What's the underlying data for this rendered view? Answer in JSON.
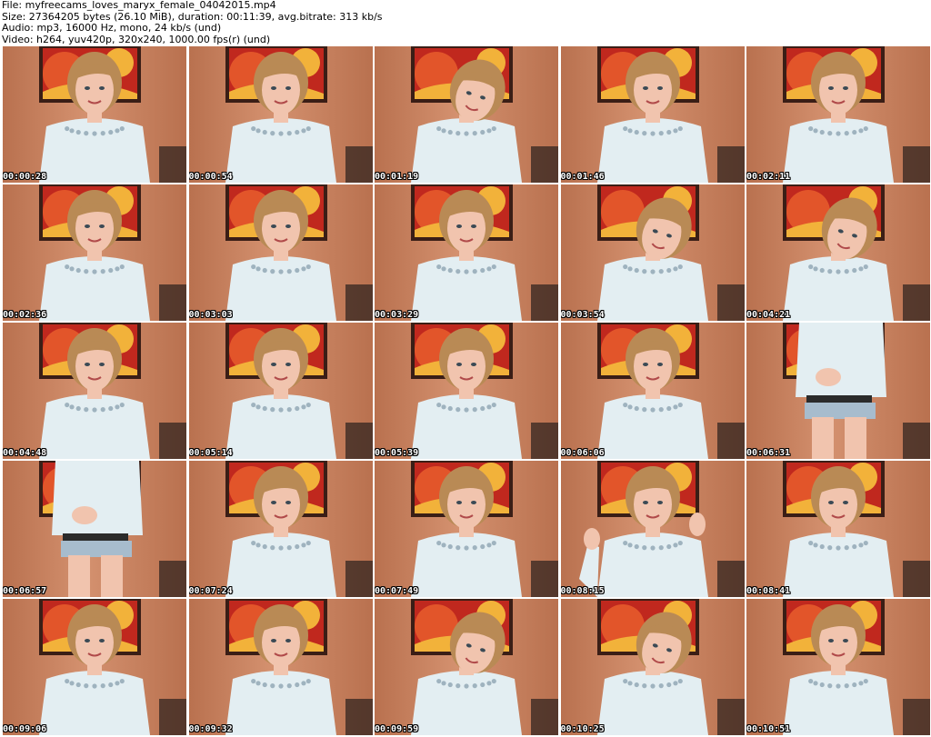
{
  "header": {
    "file_line": "File: myfreecams_loves_maryx_female_04042015.mp4",
    "size_line": "Size: 27364205 bytes (26.10 MiB), duration: 00:11:39, avg.bitrate: 313 kb/s",
    "audio_line": "Audio: mp3, 16000 Hz, mono, 24 kb/s (und)",
    "video_line": "Video: h264, yuv420p, 320x240, 1000.00 fps(r) (und)"
  },
  "colors": {
    "wall": "#d4916f",
    "wall_dark": "#b9714f",
    "painting_orange": "#e2552a",
    "painting_yellow": "#f2b23a",
    "painting_red": "#c0281e",
    "painting_dark": "#3a1e16",
    "sweater": "#e3eef2",
    "skin": "#f1c4ae",
    "hair": "#b98a55",
    "shorts": "#a7bccd",
    "timestamp_text": "#ffffff",
    "timestamp_outline": "#000000"
  },
  "thumbnails": [
    {
      "timestamp": "00:00:28",
      "pose": "portrait"
    },
    {
      "timestamp": "00:00:54",
      "pose": "portrait"
    },
    {
      "timestamp": "00:01:19",
      "pose": "head-down"
    },
    {
      "timestamp": "00:01:46",
      "pose": "portrait"
    },
    {
      "timestamp": "00:02:11",
      "pose": "portrait"
    },
    {
      "timestamp": "00:02:36",
      "pose": "portrait"
    },
    {
      "timestamp": "00:03:03",
      "pose": "portrait"
    },
    {
      "timestamp": "00:03:29",
      "pose": "portrait"
    },
    {
      "timestamp": "00:03:54",
      "pose": "head-down"
    },
    {
      "timestamp": "00:04:21",
      "pose": "head-down"
    },
    {
      "timestamp": "00:04:48",
      "pose": "portrait"
    },
    {
      "timestamp": "00:05:14",
      "pose": "portrait"
    },
    {
      "timestamp": "00:05:39",
      "pose": "portrait"
    },
    {
      "timestamp": "00:06:06",
      "pose": "portrait"
    },
    {
      "timestamp": "00:06:31",
      "pose": "standing"
    },
    {
      "timestamp": "00:06:57",
      "pose": "standing"
    },
    {
      "timestamp": "00:07:24",
      "pose": "portrait"
    },
    {
      "timestamp": "00:07:49",
      "pose": "portrait"
    },
    {
      "timestamp": "00:08:15",
      "pose": "hands-up"
    },
    {
      "timestamp": "00:08:41",
      "pose": "portrait"
    },
    {
      "timestamp": "00:09:06",
      "pose": "portrait"
    },
    {
      "timestamp": "00:09:32",
      "pose": "portrait"
    },
    {
      "timestamp": "00:09:59",
      "pose": "head-down"
    },
    {
      "timestamp": "00:10:25",
      "pose": "head-down"
    },
    {
      "timestamp": "00:10:51",
      "pose": "portrait"
    }
  ]
}
